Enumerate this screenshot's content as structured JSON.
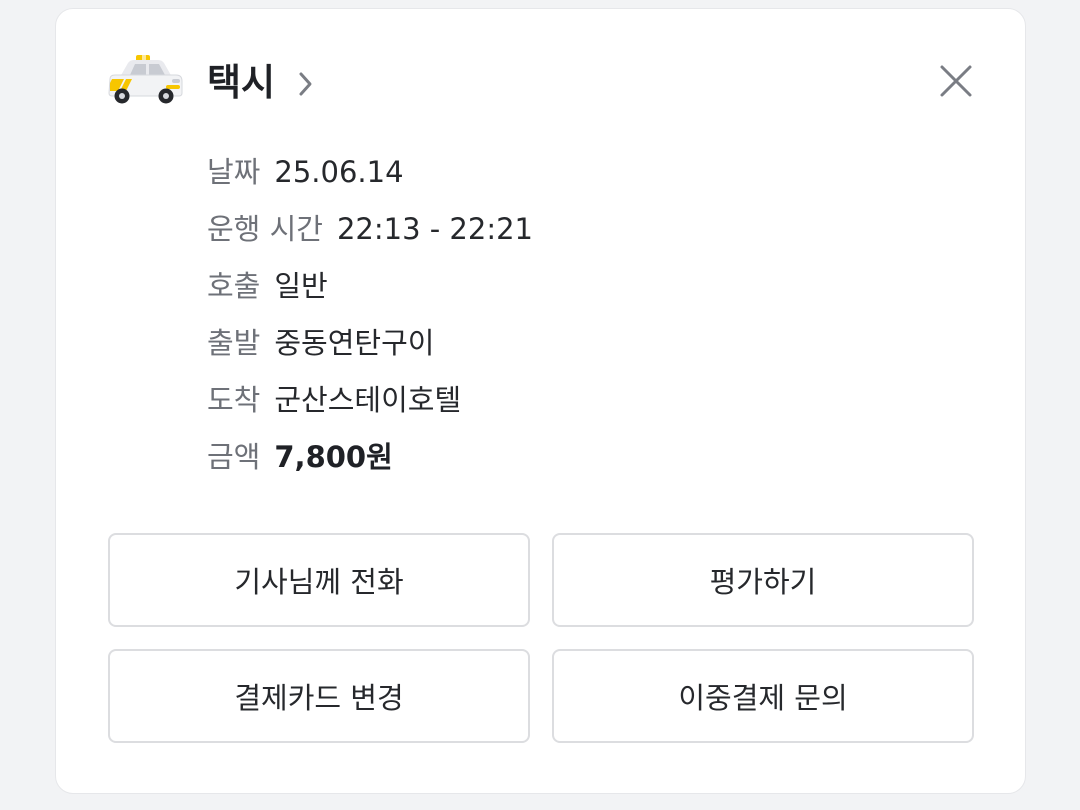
{
  "card": {
    "title": "택시",
    "icons": {
      "service": "taxi-icon",
      "title_link": "chevron-right-icon",
      "close": "close-icon"
    },
    "details": [
      {
        "label": "날짜",
        "value": "25.06.14"
      },
      {
        "label": "운행 시간",
        "value": "22:13 - 22:21"
      },
      {
        "label": "호출",
        "value": "일반"
      },
      {
        "label": "출발",
        "value": "중동연탄구이"
      },
      {
        "label": "도착",
        "value": "군산스테이호텔"
      },
      {
        "label": "금액",
        "value": "7,800원"
      }
    ],
    "buttons": {
      "call_driver": "기사님께 전화",
      "rate": "평가하기",
      "change_card": "결제카드 변경",
      "double_payment_inquiry": "이중결제 문의"
    }
  },
  "colors": {
    "taxi_yellow": "#f7c600",
    "text_primary": "#1f2126",
    "text_secondary": "#6e7178",
    "border": "#dcdde0"
  }
}
